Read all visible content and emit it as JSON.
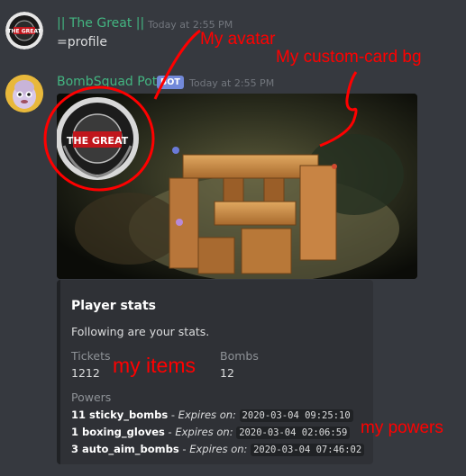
{
  "messages": [
    {
      "author": "|| The Great ||",
      "author_color": "#43b581",
      "timestamp": "Today at 2:55 PM",
      "content": "=profile",
      "avatar_text": "THE GREAT"
    },
    {
      "author": "BombSquad Pot",
      "author_color": "#43b581",
      "bot_tag": "BOT",
      "timestamp": "Today at 2:55 PM"
    }
  ],
  "embed": {
    "image_avatar_text": "THE GREAT",
    "title": "Player stats",
    "description": "Following are your stats.",
    "fields": [
      {
        "name": "Tickets",
        "value": "1212"
      },
      {
        "name": "Bombs",
        "value": "12"
      }
    ],
    "powers_label": "Powers",
    "powers": [
      {
        "item": "11 sticky_bombs",
        "sep": " - ",
        "expires_label": "Expires on:",
        "date": "2020-03-04 09:25:10"
      },
      {
        "item": "1 boxing_gloves",
        "sep": " - ",
        "expires_label": "Expires on:",
        "date": "2020-03-04 02:06:59"
      },
      {
        "item": "3 auto_aim_bombs",
        "sep": " - ",
        "expires_label": "Expires on:",
        "date": "2020-03-04 07:46:02"
      }
    ]
  },
  "annotations": {
    "avatar_note": "My avatar",
    "card_bg_note": "My custom-card bg",
    "items_note": "my items",
    "powers_note": "my powers",
    "color": "#ff0000"
  }
}
